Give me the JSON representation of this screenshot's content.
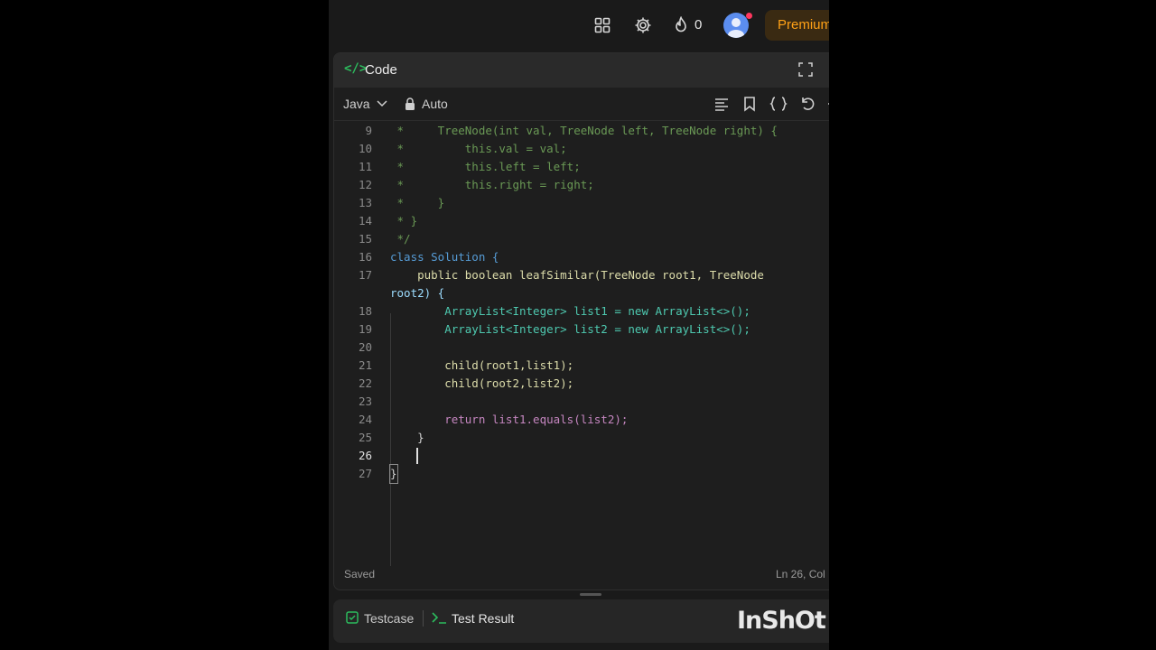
{
  "topbar": {
    "streak_count": "0",
    "premium_label": "Premium"
  },
  "panel": {
    "title": "Code"
  },
  "toolbar": {
    "language": "Java",
    "mode": "Auto"
  },
  "editor": {
    "active_line": "26",
    "lines": [
      {
        "n": "9",
        "code": " *     TreeNode(int val, TreeNode left, TreeNode right) {"
      },
      {
        "n": "10",
        "code": " *         this.val = val;"
      },
      {
        "n": "11",
        "code": " *         this.left = left;"
      },
      {
        "n": "12",
        "code": " *         this.right = right;"
      },
      {
        "n": "13",
        "code": " *     }"
      },
      {
        "n": "14",
        "code": " * }"
      },
      {
        "n": "15",
        "code": " */"
      },
      {
        "n": "16",
        "code": "class Solution {"
      },
      {
        "n": "17",
        "code": "    public boolean leafSimilar(TreeNode root1, TreeNode"
      },
      {
        "n": "",
        "code": "root2) {"
      },
      {
        "n": "18",
        "code": "        ArrayList<Integer> list1 = new ArrayList<>();"
      },
      {
        "n": "19",
        "code": "        ArrayList<Integer> list2 = new ArrayList<>();"
      },
      {
        "n": "20",
        "code": ""
      },
      {
        "n": "21",
        "code": "        child(root1,list1);"
      },
      {
        "n": "22",
        "code": "        child(root2,list2);"
      },
      {
        "n": "23",
        "code": ""
      },
      {
        "n": "24",
        "code": "        return list1.equals(list2);"
      },
      {
        "n": "25",
        "code": "    }"
      },
      {
        "n": "26",
        "code": ""
      },
      {
        "n": "27",
        "code": "}"
      }
    ]
  },
  "status": {
    "saved": "Saved",
    "cursor": "Ln 26, Col"
  },
  "bottom": {
    "tab_testcase": "Testcase",
    "tab_result": "Test Result"
  },
  "watermark": "InShOt",
  "colors": {
    "accent_green": "#2cbb5d",
    "premium": "#ffa116"
  }
}
